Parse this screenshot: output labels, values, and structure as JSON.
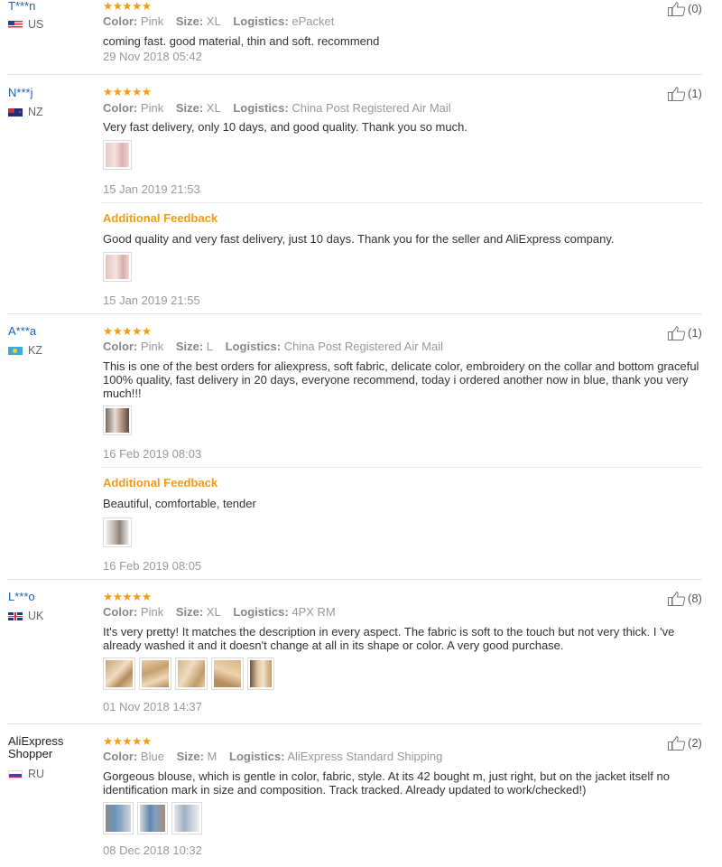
{
  "labels": {
    "color": "Color:",
    "size": "Size:",
    "logistics": "Logistics:",
    "additional_feedback": "Additional Feedback"
  },
  "reviews": [
    {
      "user": "T***n",
      "country": "US",
      "stars": "★★★★★",
      "color": "Pink",
      "size": "XL",
      "logistics": "ePacket",
      "helpful": "(0)",
      "text": "coming fast. good material, thin and soft. recommend",
      "date": "29 Nov 2018 05:42"
    },
    {
      "user": "N***j",
      "country": "NZ",
      "stars": "★★★★★",
      "color": "Pink",
      "size": "XL",
      "logistics": "China Post Registered Air Mail",
      "helpful": "(1)",
      "text": "Very fast delivery, only 10 days, and good quality. Thank you so much.",
      "date": "15 Jan 2019 21:53",
      "additional_text": "Good quality and very fast delivery, just 10 days. Thank you for the seller and AliExpress company.",
      "additional_date": "15 Jan 2019 21:55"
    },
    {
      "user": "A***a",
      "country": "KZ",
      "stars": "★★★★★",
      "color": "Pink",
      "size": "L",
      "logistics": "China Post Registered Air Mail",
      "helpful": "(1)",
      "text": "This is one of the best orders for aliexpress, soft fabric, delicate color, embroidery on the collar and bottom graceful 100% quality, fast delivery in 20 days, everyone recommend, today i ordered another now in blue, thank you very much!!!",
      "date": "16 Feb 2019 08:03",
      "additional_text": "Beautiful, comfortable, tender",
      "additional_date": "16 Feb 2019 08:05"
    },
    {
      "user": "L***o",
      "country": "UK",
      "stars": "★★★★★",
      "color": "Pink",
      "size": "XL",
      "logistics": "4PX RM",
      "helpful": "(8)",
      "text": "It's very pretty! It matches the description in every aspect. The fabric is soft to the touch but not very thick. I 've already washed it and it doesn't change at all in its shape or color. A very good purchase.",
      "date": "01 Nov 2018 14:37"
    },
    {
      "user": "AliExpress Shopper",
      "country": "RU",
      "stars": "★★★★★",
      "color": "Blue",
      "size": "M",
      "logistics": "AliExpress Standard Shipping",
      "helpful": "(2)",
      "text": "Gorgeous blouse, which is gentle in color, fabric, style. At its 42 bought m, just right, but on the jacket itself no identification mark in size and composition. Track tracked. Already updated to work/checked!)",
      "date": "08 Dec 2018 10:32"
    }
  ],
  "colors": {
    "star": "#f39c12",
    "username": "#1f5fb5",
    "additional": "#f39c12",
    "muted": "#999999"
  }
}
